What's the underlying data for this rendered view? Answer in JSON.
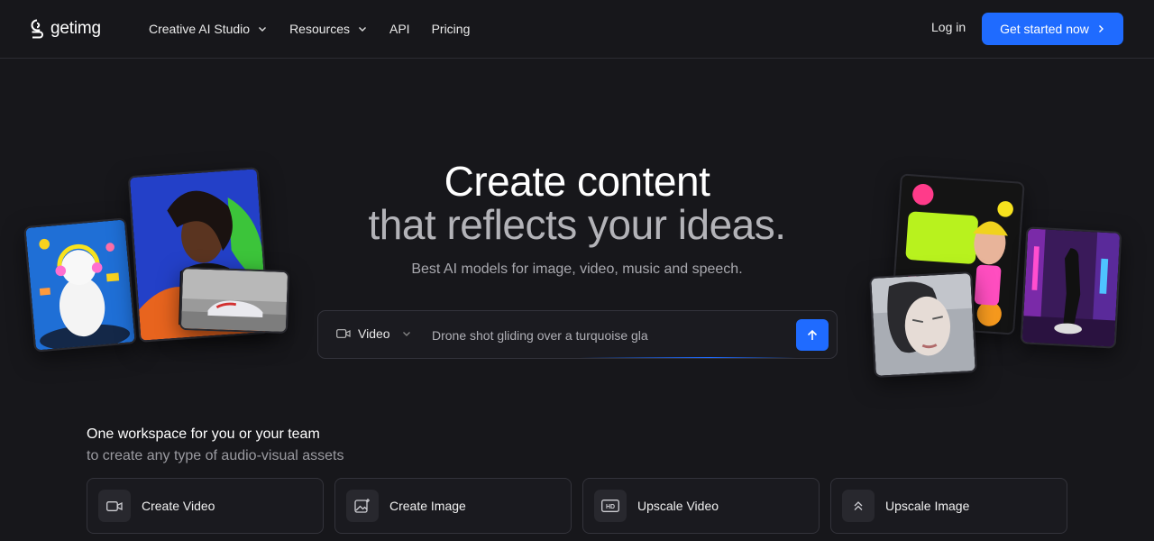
{
  "header": {
    "logo_text": "getimg",
    "nav": [
      {
        "label": "Creative AI Studio",
        "has_dropdown": true
      },
      {
        "label": "Resources",
        "has_dropdown": true
      },
      {
        "label": "API",
        "has_dropdown": false
      },
      {
        "label": "Pricing",
        "has_dropdown": false
      }
    ],
    "login_label": "Log in",
    "cta_label": "Get started now"
  },
  "hero": {
    "title_line1": "Create content",
    "title_line2": "that reflects your ideas.",
    "subtitle": "Best AI models for image, video, music and speech."
  },
  "prompt": {
    "mode_label": "Video",
    "mode_icon": "video-camera-icon",
    "input_value": "Drone shot gliding over a turquoise gla",
    "send_icon": "arrow-up-icon"
  },
  "workspace": {
    "title": "One workspace for you or your team",
    "subtitle": "to create any type of audio-visual assets",
    "tools": [
      {
        "label": "Create Video",
        "icon": "video-camera-icon"
      },
      {
        "label": "Create Image",
        "icon": "image-sparkle-icon"
      },
      {
        "label": "Upscale Video",
        "icon": "hd-icon"
      },
      {
        "label": "Upscale Image",
        "icon": "chevrons-up-icon"
      }
    ]
  },
  "colors": {
    "background": "#17171b",
    "accent": "#1f6bff",
    "border": "#33333b",
    "muted_text": "#9a9aa0"
  }
}
